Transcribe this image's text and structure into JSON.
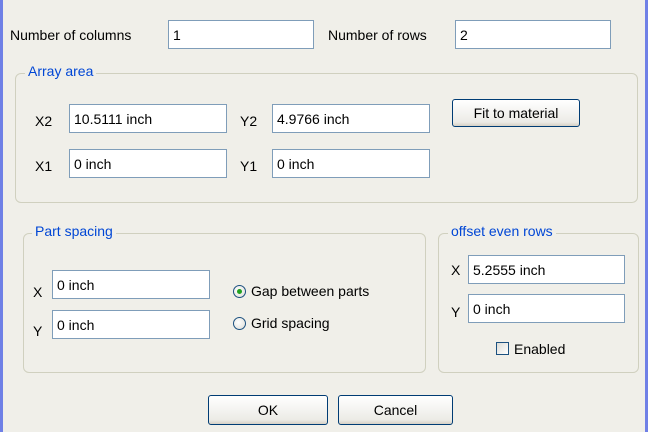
{
  "fields": {
    "columns": {
      "label": "Number of columns",
      "value": "1"
    },
    "rows": {
      "label": "Number of rows",
      "value": "2"
    }
  },
  "array_area": {
    "title": "Array area",
    "x2": {
      "label": "X2",
      "value": "10.5111 inch"
    },
    "y2": {
      "label": "Y2",
      "value": "4.9766 inch"
    },
    "x1": {
      "label": "X1",
      "value": "0 inch"
    },
    "y1": {
      "label": "Y1",
      "value": "0 inch"
    },
    "fit_button": "Fit to material"
  },
  "part_spacing": {
    "title": "Part spacing",
    "x": {
      "label": "X",
      "value": "0 inch"
    },
    "y": {
      "label": "Y",
      "value": "0 inch"
    },
    "options": [
      {
        "label": "Gap between parts",
        "selected": true
      },
      {
        "label": "Grid spacing",
        "selected": false
      }
    ]
  },
  "offset_even_rows": {
    "title": "offset even rows",
    "x": {
      "label": "X",
      "value": "5.2555 inch"
    },
    "y": {
      "label": "Y",
      "value": "0 inch"
    },
    "enabled": {
      "label": "Enabled",
      "checked": false
    }
  },
  "buttons": {
    "ok": "OK",
    "cancel": "Cancel"
  },
  "colors": {
    "accent_frame": "#6f80e6",
    "legend_text": "#0046d5",
    "radio_selected": "#21a121"
  }
}
